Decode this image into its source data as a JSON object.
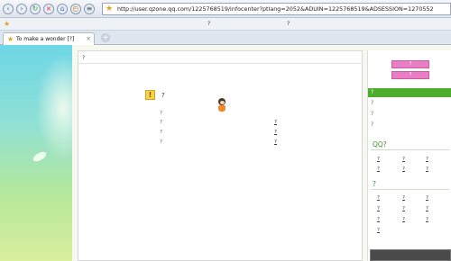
{
  "browser": {
    "back_icon": "back-arrow-icon",
    "forward_icon": "forward-arrow-icon",
    "refresh_icon": "refresh-icon",
    "stop_icon": "stop-icon",
    "home_icon": "home-icon",
    "address": "http://user.qzone.qq.com/1225768519/infocenter?ptlang=2052&ADUIN=1225768519&ADSESSION=1270552",
    "fav_bar": {
      "item_1": "?",
      "item_2": "?"
    },
    "tab": {
      "title": "To make a wonder [?]"
    }
  },
  "colors": {
    "green_active": "#4cae2c",
    "pink_button": "#e97ec4",
    "link_green": "#2a8a2a"
  },
  "main": {
    "breadcrumb": "?",
    "notice_title": "?",
    "tips_label": "?",
    "tips": [
      {
        "text": "?",
        "link": "?"
      },
      {
        "text": "?",
        "link": "?"
      },
      {
        "text": "?",
        "link": "?"
      }
    ]
  },
  "sidebar": {
    "buttons": [
      "?",
      "?"
    ],
    "nav": [
      {
        "label": "?",
        "active": true
      },
      {
        "label": "?",
        "active": false
      },
      {
        "label": "?",
        "active": false
      },
      {
        "label": "?",
        "active": false
      }
    ],
    "section_1": {
      "title": "QQ?",
      "links": [
        "?",
        "?",
        "?",
        "?",
        "?",
        "?"
      ]
    },
    "section_2": {
      "title": "?",
      "links": [
        "?",
        "?",
        "?",
        "?",
        "?",
        "?",
        "?",
        "?",
        "?",
        "?"
      ]
    }
  }
}
